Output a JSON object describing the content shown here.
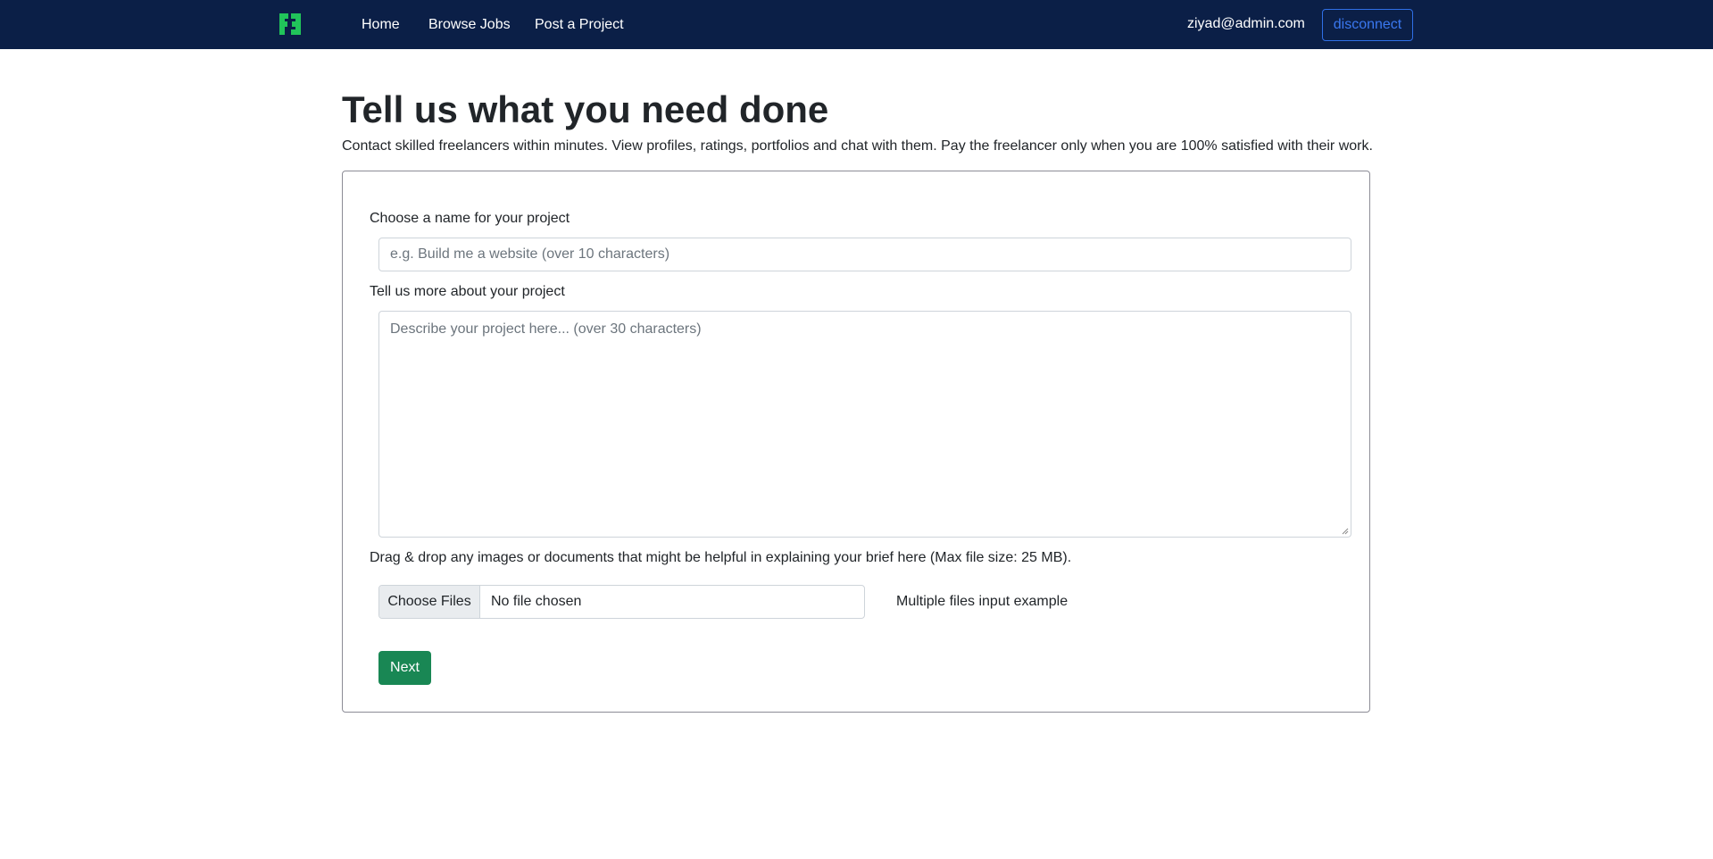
{
  "nav": {
    "logo_icon": "f-logo-icon",
    "logo_color": "#21c45a",
    "links": [
      "Home",
      "Browse Jobs",
      "Post a Project"
    ],
    "user_email": "ziyad@admin.com",
    "disconnect_label": "disconnect",
    "bar_color": "#0b1f47"
  },
  "main": {
    "title": "Tell us what you need done",
    "subtitle": "Contact skilled freelancers within minutes. View profiles, ratings, portfolios and chat with them. Pay the freelancer only when you are 100% satisfied with their work."
  },
  "form": {
    "name_label": "Choose a name for your project",
    "name_placeholder": "e.g. Build me a website (over 10 characters)",
    "description_label": "Tell us more about your project",
    "description_placeholder": "Describe your project here... (over 30 characters)",
    "files_label": "Drag & drop any images or documents that might be helpful in explaining your brief here (Max file size: 25 MB).",
    "choose_files_label": "Choose Files",
    "file_status": "No file chosen",
    "files_helper": "Multiple files input example",
    "next_label": "Next",
    "next_color": "#198754"
  }
}
